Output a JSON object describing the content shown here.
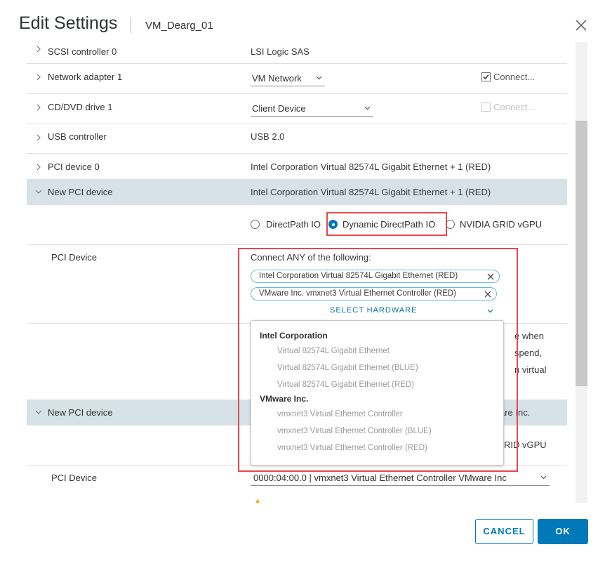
{
  "dialog": {
    "title": "Edit Settings",
    "vm_name": "VM_Dearg_01"
  },
  "rows": {
    "scsi": {
      "label": "SCSI controller 0",
      "value": "LSI Logic SAS"
    },
    "network": {
      "label": "Network adapter 1",
      "select_value": "VM Network",
      "connect_label": "Connect...",
      "connect_checked": true
    },
    "cddvd": {
      "label": "CD/DVD drive 1",
      "select_value": "Client Device",
      "connect_label": "Connect...",
      "connect_checked": false
    },
    "usb": {
      "label": "USB controller",
      "value": "USB 2.0"
    },
    "pci0": {
      "label": "PCI device 0",
      "value": "Intel Corporation Virtual 82574L Gigabit Ethernet + 1 (RED)"
    },
    "new_pci_1": {
      "label": "New PCI device",
      "value": "Intel Corporation Virtual 82574L Gigabit Ethernet + 1 (RED)",
      "radio_options": [
        "DirectPath IO",
        "Dynamic DirectPath IO",
        "NVIDIA GRID vGPU"
      ],
      "selected_option": "Dynamic DirectPath IO",
      "pci_device_label": "PCI Device",
      "connect_any_label": "Connect ANY of the following:",
      "chips": [
        "Intel Corporation Virtual 82574L Gigabit Ethernet (RED)",
        "VMware Inc. vmxnet3 Virtual Ethernet Controller (RED)"
      ],
      "select_hardware_label": "SELECT HARDWARE",
      "hidden_note_fragments": [
        "e when",
        "spend,",
        "n virtual"
      ]
    },
    "new_pci_2": {
      "label": "New PCI device",
      "value_fragment": "are Inc.",
      "radio_fragment": "RID vGPU",
      "pci_device_label": "PCI Device",
      "select_value": "0000:04:00.0 | vmxnet3 Virtual Ethernet Controller VMware Inc"
    }
  },
  "hardware_dropdown": {
    "groups": [
      {
        "name": "Intel Corporation",
        "items": [
          "Virtual 82574L Gigabit Ethernet",
          "Virtual 82574L Gigabit Ethernet (BLUE)",
          "Virtual 82574L Gigabit Ethernet (RED)"
        ]
      },
      {
        "name": "VMware Inc.",
        "items": [
          "vmxnet3 Virtual Ethernet Controller",
          "vmxnet3 Virtual Ethernet Controller (BLUE)",
          "vmxnet3 Virtual Ethernet Controller (RED)"
        ]
      }
    ]
  },
  "footer": {
    "cancel_label": "CANCEL",
    "ok_label": "OK"
  },
  "colors": {
    "accent": "#0079b8",
    "highlight_row": "#d7e1e8",
    "annotation": "#e5484d"
  },
  "icons": {
    "close": "close-icon",
    "expand": "chevron-right-icon",
    "collapse": "chevron-down-icon",
    "remove_chip": "close-icon",
    "warning": "warning-icon"
  }
}
